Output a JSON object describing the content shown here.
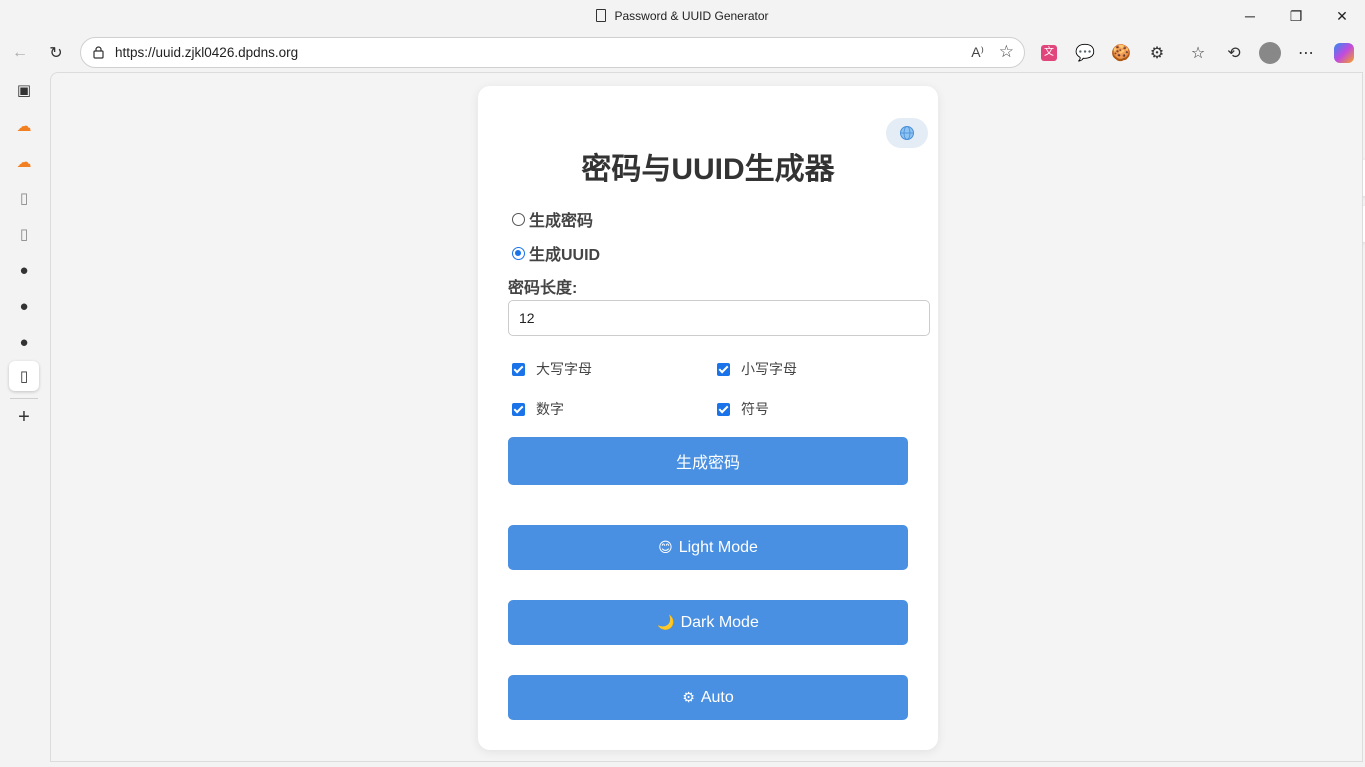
{
  "window": {
    "title": "Password & UUID Generator",
    "minimize": "─",
    "maximize": "❐",
    "close": "✕"
  },
  "toolbar": {
    "url": "https://uuid.zjkl0426.dpdns.org",
    "read_aloud": "A⁾"
  },
  "app": {
    "lang_icon": "globe-icon",
    "heading": "密码与UUID生成器",
    "mode_options": [
      {
        "label": "生成密码",
        "checked": false
      },
      {
        "label": "生成UUID",
        "checked": true
      }
    ],
    "length_label": "密码长度:",
    "length_value": "12",
    "options": [
      {
        "label": "大写字母",
        "checked": true
      },
      {
        "label": "小写字母",
        "checked": true
      },
      {
        "label": "数字",
        "checked": true
      },
      {
        "label": "符号",
        "checked": true
      }
    ],
    "generate_button": "生成密码",
    "theme_buttons": [
      {
        "icon": "😊",
        "label": "Light Mode"
      },
      {
        "icon": "🌙",
        "label": "Dark Mode"
      },
      {
        "icon": "⚙",
        "label": "Auto"
      }
    ]
  },
  "colors": {
    "accent": "#4a90e2",
    "checkbox": "#1a73e8"
  }
}
